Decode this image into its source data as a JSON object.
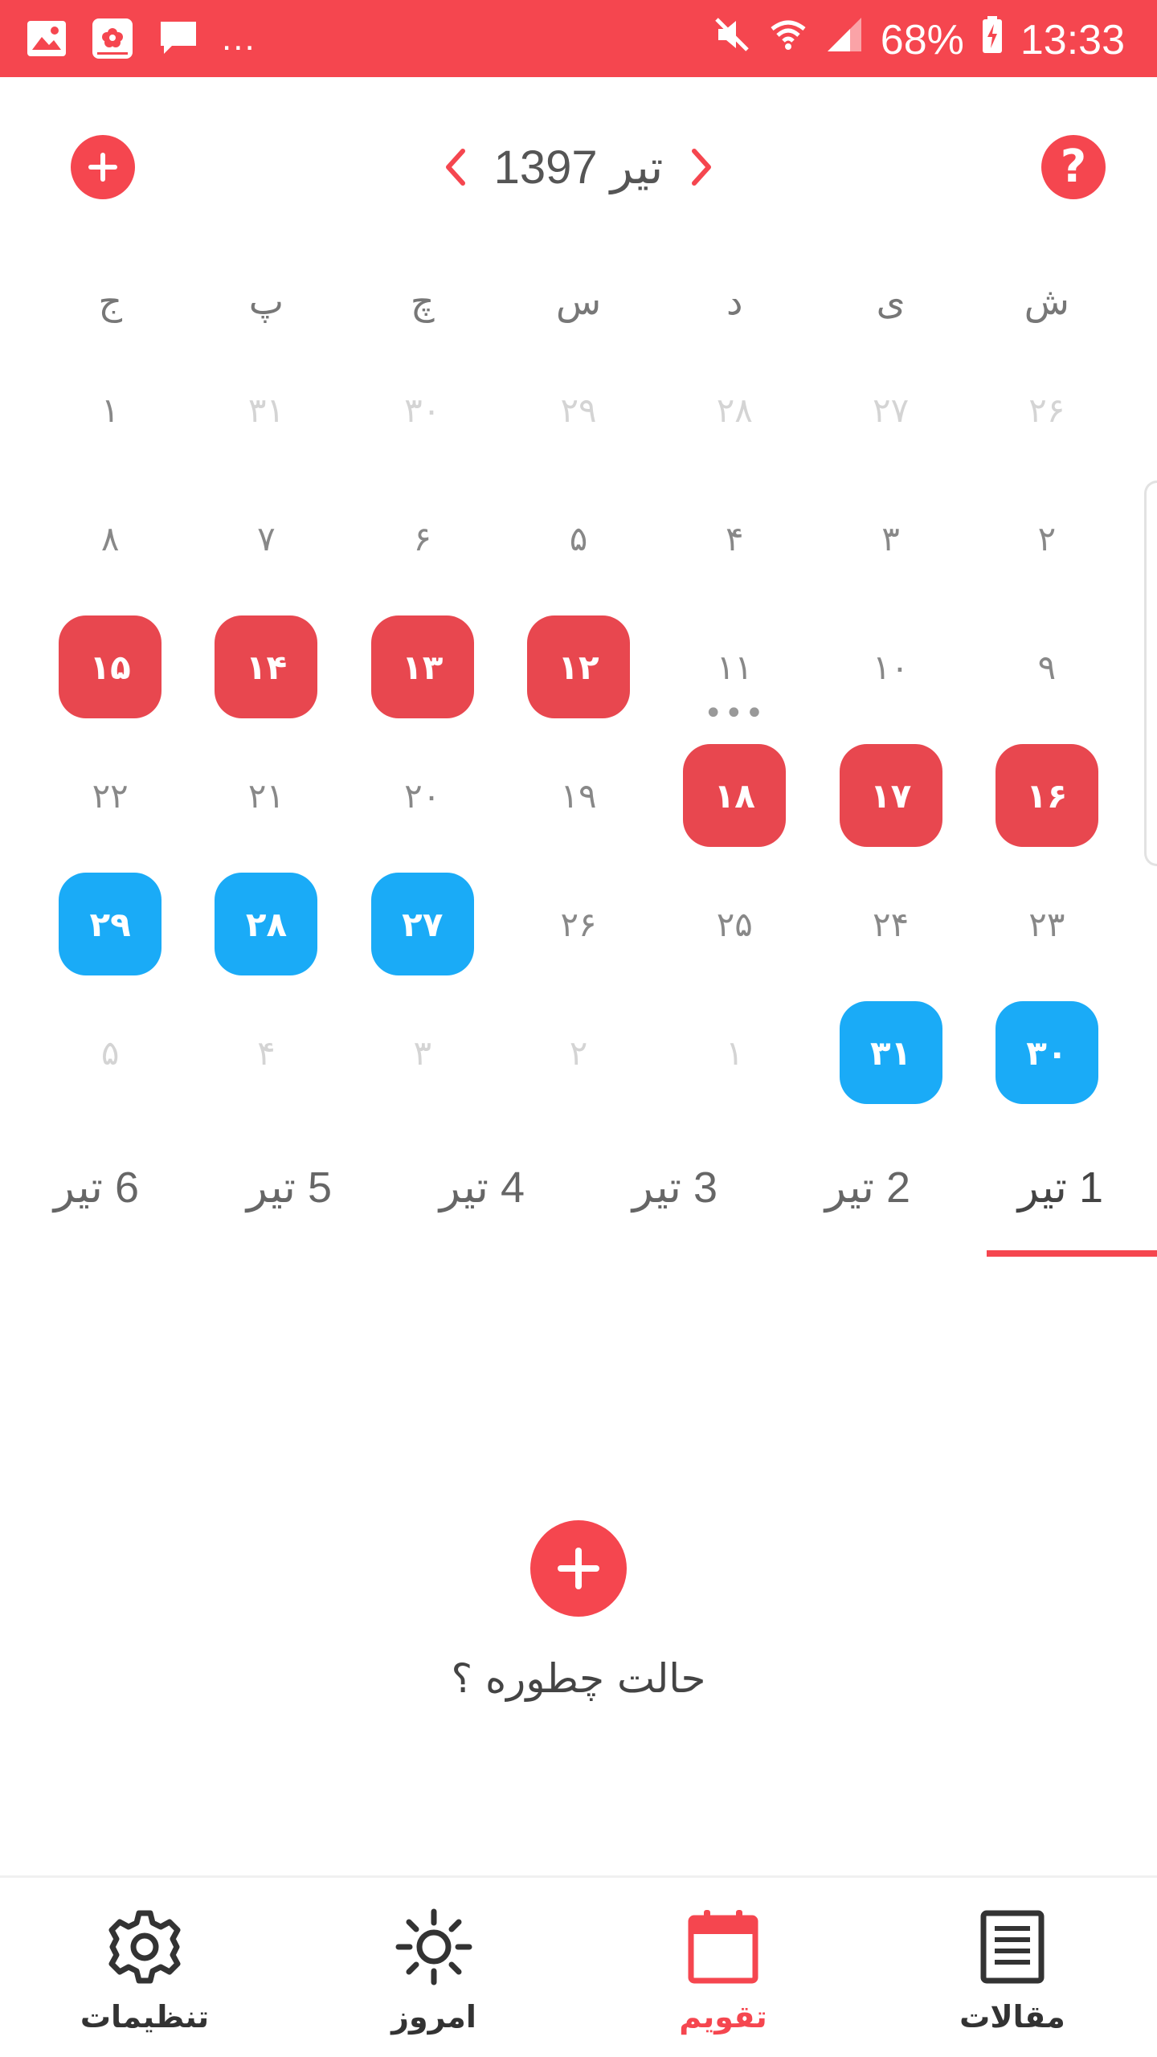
{
  "status_bar": {
    "left_icons": [
      "gallery-icon",
      "flower-app-icon",
      "message-icon"
    ],
    "more": "...",
    "battery": "68%",
    "time": "13:33"
  },
  "header": {
    "month_title": "تیر 1397"
  },
  "weekdays": [
    "ش",
    "ی",
    "د",
    "س",
    "چ",
    "پ",
    "ج"
  ],
  "weeks": [
    [
      {
        "label": "۲۶",
        "style": "faded"
      },
      {
        "label": "۲۷",
        "style": "faded"
      },
      {
        "label": "۲۸",
        "style": "faded"
      },
      {
        "label": "۲۹",
        "style": "faded"
      },
      {
        "label": "۳۰",
        "style": "faded"
      },
      {
        "label": "۳۱",
        "style": "faded"
      },
      {
        "label": "۱",
        "style": "normal"
      }
    ],
    [
      {
        "label": "۲",
        "style": "normal"
      },
      {
        "label": "۳",
        "style": "normal"
      },
      {
        "label": "۴",
        "style": "normal"
      },
      {
        "label": "۵",
        "style": "normal"
      },
      {
        "label": "۶",
        "style": "normal"
      },
      {
        "label": "۷",
        "style": "normal"
      },
      {
        "label": "۸",
        "style": "normal"
      }
    ],
    [
      {
        "label": "۹",
        "style": "normal"
      },
      {
        "label": "۱۰",
        "style": "normal"
      },
      {
        "label": "۱۱",
        "style": "normal",
        "dots": "•••"
      },
      {
        "label": "۱۲",
        "style": "red"
      },
      {
        "label": "۱۳",
        "style": "red"
      },
      {
        "label": "۱۴",
        "style": "red"
      },
      {
        "label": "۱۵",
        "style": "red"
      }
    ],
    [
      {
        "label": "۱۶",
        "style": "red"
      },
      {
        "label": "۱۷",
        "style": "red"
      },
      {
        "label": "۱۸",
        "style": "red"
      },
      {
        "label": "۱۹",
        "style": "normal"
      },
      {
        "label": "۲۰",
        "style": "normal"
      },
      {
        "label": "۲۱",
        "style": "normal"
      },
      {
        "label": "۲۲",
        "style": "normal"
      }
    ],
    [
      {
        "label": "۲۳",
        "style": "normal"
      },
      {
        "label": "۲۴",
        "style": "normal"
      },
      {
        "label": "۲۵",
        "style": "normal"
      },
      {
        "label": "۲۶",
        "style": "normal"
      },
      {
        "label": "۲۷",
        "style": "blue"
      },
      {
        "label": "۲۸",
        "style": "blue"
      },
      {
        "label": "۲۹",
        "style": "blue"
      }
    ],
    [
      {
        "label": "۳۰",
        "style": "blue"
      },
      {
        "label": "۳۱",
        "style": "blue"
      },
      {
        "label": "۱",
        "style": "faded"
      },
      {
        "label": "۲",
        "style": "faded"
      },
      {
        "label": "۳",
        "style": "faded"
      },
      {
        "label": "۴",
        "style": "faded"
      },
      {
        "label": "۵",
        "style": "faded"
      }
    ]
  ],
  "day_tabs": [
    "1 تیر",
    "2 تیر",
    "3 تیر",
    "4 تیر",
    "5 تیر",
    "6 تیر"
  ],
  "active_tab": 0,
  "empty_state": {
    "prompt": "حالت چطوره ؟"
  },
  "bottom_nav": [
    {
      "label": "مقالات",
      "icon": "articles-icon",
      "active": false
    },
    {
      "label": "تقویم",
      "icon": "calendar-icon",
      "active": true
    },
    {
      "label": "امروز",
      "icon": "sun-icon",
      "active": false
    },
    {
      "label": "تنظیمات",
      "icon": "gear-icon",
      "active": false
    }
  ],
  "colors": {
    "accent": "#f5464f",
    "period_red": "#e8474f",
    "fertile_blue": "#1aabf7",
    "muted": "#d4d4d4"
  }
}
